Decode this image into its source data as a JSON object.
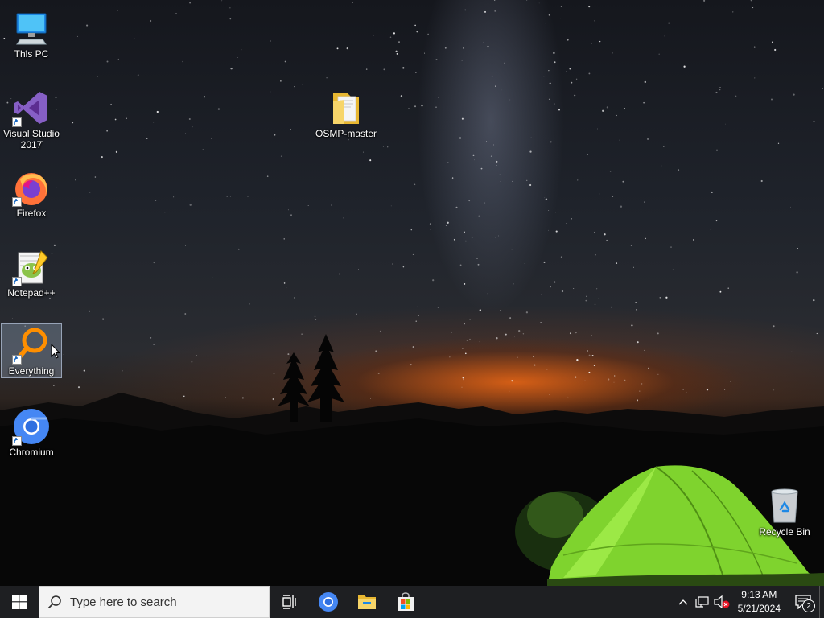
{
  "desktop": {
    "icons": [
      {
        "label": "This PC",
        "icon": "this-pc-icon"
      },
      {
        "label": "Visual Studio\n2017",
        "icon": "visual-studio-icon"
      },
      {
        "label": "Firefox",
        "icon": "firefox-icon"
      },
      {
        "label": "Notepad++",
        "icon": "notepad-plus-plus-icon"
      },
      {
        "label": "Everything",
        "icon": "everything-search-icon",
        "selected": true
      },
      {
        "label": "Chromium",
        "icon": "chromium-icon"
      },
      {
        "label": "OSMP-master",
        "icon": "folder-icon"
      },
      {
        "label": "Recycle Bin",
        "icon": "recycle-bin-icon"
      }
    ]
  },
  "taskbar": {
    "search_placeholder": "Type here to search",
    "pinned": [
      "task-view-icon",
      "chromium-icon",
      "file-explorer-icon",
      "microsoft-store-icon"
    ],
    "clock": {
      "time": "9:13 AM",
      "date": "5/21/2024"
    },
    "notifications_count": "2"
  },
  "colors": {
    "taskbar": "#1e1f22",
    "search_box": "#f3f3f3",
    "accent": "#0078d7",
    "tent": "#8ee53a"
  }
}
